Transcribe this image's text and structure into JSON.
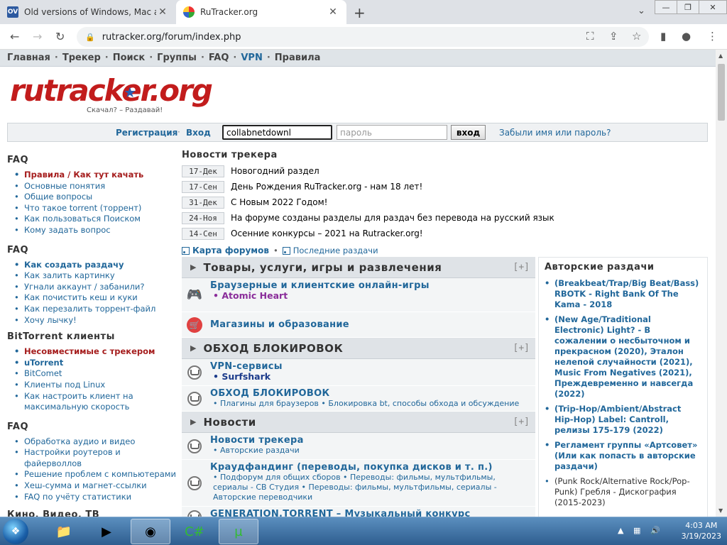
{
  "browser": {
    "tabs": [
      {
        "favicon": "OV",
        "title": "Old versions of Windows, Mac an"
      },
      {
        "favicon": "",
        "title": "RuTracker.org"
      }
    ],
    "url": "rutracker.org/forum/index.php"
  },
  "topnav": [
    "Главная",
    "Трекер",
    "Поиск",
    "Группы",
    "FAQ",
    "VPN",
    "Правила"
  ],
  "logo": {
    "text_a": "rutracker",
    "text_b": ".org",
    "slogan": "Скачал? – Раздавай!"
  },
  "login": {
    "register": "Регистрация",
    "enter": "Вход",
    "username_value": "collabnetdownl",
    "password_placeholder": "пароль",
    "submit": "вход",
    "forgot": "Забыли имя или пароль?"
  },
  "sidebar": [
    {
      "title": "FAQ",
      "items": [
        {
          "text": "Правила",
          "text2": "Как тут качать",
          "style": "red"
        },
        {
          "text": "Основные понятия"
        },
        {
          "text": "Общие вопросы"
        },
        {
          "text": "Что такое torrent (торрент)"
        },
        {
          "text": "Как пользоваться Поиском"
        },
        {
          "text": "Кому задать вопрос"
        }
      ]
    },
    {
      "title": "FAQ",
      "items": [
        {
          "text": "Как создать раздачу",
          "style": "bold"
        },
        {
          "text": "Как залить картинку"
        },
        {
          "text": "Угнали аккаунт / забанили?"
        },
        {
          "text": "Как почистить кеш и куки"
        },
        {
          "text": "Как перезалить торрент-файл"
        },
        {
          "text": "Хочу лычку!"
        }
      ]
    },
    {
      "title": "BitTorrent клиенты",
      "items": [
        {
          "text": "Несовместимые с трекером",
          "style": "red"
        },
        {
          "text": "uTorrent",
          "style": "bold"
        },
        {
          "text": "BitComet"
        },
        {
          "text": "Клиенты под Linux"
        },
        {
          "text": "Как настроить клиент на максимальную скорость"
        }
      ]
    },
    {
      "title": "FAQ",
      "items": [
        {
          "text": "Обработка аудио и видео"
        },
        {
          "text": "Настройки роутеров и файерволлов"
        },
        {
          "text": "Решение проблем с компьютерами"
        },
        {
          "text": "Хеш-сумма и магнет-ссылки"
        },
        {
          "text": "FAQ по учёту статистики"
        }
      ]
    },
    {
      "title": "Кино, Видео, ТВ",
      "items": []
    }
  ],
  "news": {
    "title": "Новости трекера",
    "items": [
      {
        "date": "17-Дек",
        "text": "Новогодний раздел"
      },
      {
        "date": "17-Сен",
        "text": "День Рождения RuTracker.org - нам 18 лет!"
      },
      {
        "date": "31-Дек",
        "text": "С Новым 2022 Годом!"
      },
      {
        "date": "24-Ноя",
        "text": "На форуме созданы разделы для раздач без перевода на русский язык"
      },
      {
        "date": "14-Сен",
        "text": "Осенние конкурсы – 2021 на Rutracker.org!"
      }
    ],
    "map_link": "Карта форумов",
    "recent_link": "Последние раздачи"
  },
  "forum": {
    "categories": [
      {
        "title": "Товары, услуги, игры и развлечения",
        "expand": "[+]",
        "rows": [
          {
            "icon": "gamepad-icon",
            "title": "Браузерные и клиентские онлайн-игры",
            "sub": "• Atomic Heart",
            "sub_style": "purple-bold"
          },
          {
            "icon": "shop-icon",
            "title": "Магазины и образование",
            "sub": ""
          }
        ]
      },
      {
        "title": "ОБХОД БЛОКИРОВОК",
        "expand": "[+]",
        "rows": [
          {
            "icon": "forum-icon",
            "title": "VPN-сервисы",
            "sub": "• Surfshark",
            "sub_style": "bold"
          },
          {
            "icon": "forum-icon",
            "title": "ОБХОД БЛОКИРОВОК",
            "sub": "• Плагины для браузеров • Блокировка bt, способы обхода и обсуждение"
          }
        ]
      },
      {
        "title": "Новости",
        "expand": "[+]",
        "rows": [
          {
            "icon": "forum-icon",
            "title": "Новости трекера",
            "sub": "• Авторские раздачи"
          },
          {
            "icon": "forum-icon",
            "title": "Краудфандинг (переводы, покупка дисков и т. п.)",
            "sub": "• Подфорум для общих сборов • Переводы: фильмы, мультфильмы, сериалы - СВ Студия • Переводы: фильмы, мультфильмы, сериалы - Авторские переводчики"
          }
        ]
      }
    ],
    "cut_title": "GENERATION.TORRENT – Музыкальный конкурс"
  },
  "author_releases": {
    "title": "Авторские раздачи",
    "items": [
      {
        "text": "(Breakbeat/Trap/Big Beat/Bass) RBOTK - Right Bank Of The Kama - 2018",
        "style": "bold"
      },
      {
        "text": "(New Age/Traditional Electronic) Light? - В сожалении о несбыточном и прекрасном (2020), Эталон нелепой случайности (2021), Music From Negatives (2021), Преждевременно и навсегда (2022)",
        "style": "bold"
      },
      {
        "text": "(Trip-Hop/Ambient/Abstract Hip-Hop) Label: Cantroll, релизы 175-179 (2022)",
        "style": "bold"
      },
      {
        "text": "Регламент группы «Артсовет» (Или как попасть в авторские раздачи)",
        "style": "bold"
      },
      {
        "text": "(Punk Rock/Alternative Rock/Pop-Punk) Гребля - Дискография (2015-2023)",
        "style": "norm"
      }
    ]
  },
  "taskbar": {
    "time": "4:03 AM",
    "date": "3/19/2023"
  }
}
